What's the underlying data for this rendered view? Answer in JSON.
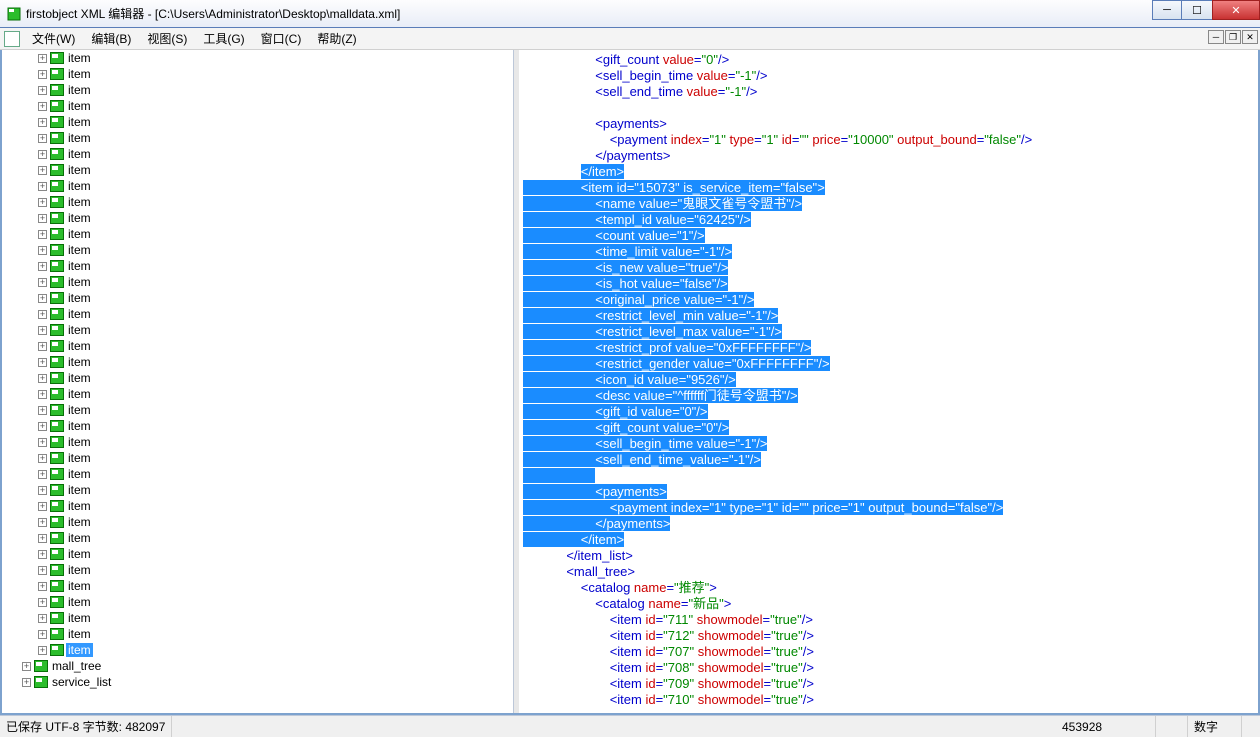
{
  "window": {
    "title": "firstobject XML 编辑器 - [C:\\Users\\Administrator\\Desktop\\malldata.xml]"
  },
  "menu": {
    "file": "文件(W)",
    "edit": "编辑(B)",
    "view": "视图(S)",
    "tools": "工具(G)",
    "window": "窗口(C)",
    "help": "帮助(Z)"
  },
  "tree": {
    "item_label": "item",
    "mall_tree": "mall_tree",
    "service_list": "service_list",
    "repeat_count": 38
  },
  "code_lines": [
    {
      "indent": 5,
      "selected": false,
      "tokens": [
        [
          "tag",
          "<gift_count "
        ],
        [
          "attr-name",
          "value"
        ],
        [
          "tag",
          "="
        ],
        [
          "attr-val",
          "\"0\""
        ],
        [
          "tag",
          "/>"
        ]
      ]
    },
    {
      "indent": 5,
      "selected": false,
      "tokens": [
        [
          "tag",
          "<sell_begin_time "
        ],
        [
          "attr-name",
          "value"
        ],
        [
          "tag",
          "="
        ],
        [
          "attr-val",
          "\"-1\""
        ],
        [
          "tag",
          "/>"
        ]
      ]
    },
    {
      "indent": 5,
      "selected": false,
      "tokens": [
        [
          "tag",
          "<sell_end_time "
        ],
        [
          "attr-name",
          "value"
        ],
        [
          "tag",
          "="
        ],
        [
          "attr-val",
          "\"-1\""
        ],
        [
          "tag",
          "/>"
        ]
      ]
    },
    {
      "indent": 0,
      "selected": false,
      "tokens": []
    },
    {
      "indent": 5,
      "selected": false,
      "tokens": [
        [
          "tag",
          "<payments>"
        ]
      ]
    },
    {
      "indent": 6,
      "selected": false,
      "tokens": [
        [
          "tag",
          "<payment "
        ],
        [
          "attr-name",
          "index"
        ],
        [
          "tag",
          "="
        ],
        [
          "attr-val",
          "\"1\""
        ],
        [
          "tag",
          " "
        ],
        [
          "attr-name",
          "type"
        ],
        [
          "tag",
          "="
        ],
        [
          "attr-val",
          "\"1\""
        ],
        [
          "tag",
          " "
        ],
        [
          "attr-name",
          "id"
        ],
        [
          "tag",
          "="
        ],
        [
          "attr-val",
          "\"\""
        ],
        [
          "tag",
          " "
        ],
        [
          "attr-name",
          "price"
        ],
        [
          "tag",
          "="
        ],
        [
          "attr-val",
          "\"10000\""
        ],
        [
          "tag",
          " "
        ],
        [
          "attr-name",
          "output_bound"
        ],
        [
          "tag",
          "="
        ],
        [
          "attr-val",
          "\"false\""
        ],
        [
          "tag",
          "/>"
        ]
      ]
    },
    {
      "indent": 5,
      "selected": false,
      "tokens": [
        [
          "tag",
          "</payments>"
        ]
      ]
    },
    {
      "indent": 4,
      "selected": true,
      "tokens": [
        [
          "tag",
          "</item>"
        ]
      ]
    },
    {
      "indent": 4,
      "selected": true,
      "tokens": [
        [
          "tag",
          "<item "
        ],
        [
          "attr-name",
          "id"
        ],
        [
          "tag",
          "="
        ],
        [
          "attr-val",
          "\"15073\""
        ],
        [
          "tag",
          " "
        ],
        [
          "attr-name",
          "is_service_item"
        ],
        [
          "tag",
          "="
        ],
        [
          "attr-val",
          "\"false\""
        ],
        [
          "tag",
          ">"
        ]
      ]
    },
    {
      "indent": 5,
      "selected": true,
      "tokens": [
        [
          "tag",
          "<name "
        ],
        [
          "attr-name",
          "value"
        ],
        [
          "tag",
          "="
        ],
        [
          "attr-val",
          "\"鬼眼文雀号令盟书\""
        ],
        [
          "tag",
          "/>"
        ]
      ]
    },
    {
      "indent": 5,
      "selected": true,
      "tokens": [
        [
          "tag",
          "<templ_id "
        ],
        [
          "attr-name",
          "value"
        ],
        [
          "tag",
          "="
        ],
        [
          "attr-val",
          "\"62425\""
        ],
        [
          "tag",
          "/>"
        ]
      ]
    },
    {
      "indent": 5,
      "selected": true,
      "tokens": [
        [
          "tag",
          "<count "
        ],
        [
          "attr-name",
          "value"
        ],
        [
          "tag",
          "="
        ],
        [
          "attr-val",
          "\"1\""
        ],
        [
          "tag",
          "/>"
        ]
      ]
    },
    {
      "indent": 5,
      "selected": true,
      "tokens": [
        [
          "tag",
          "<time_limit "
        ],
        [
          "attr-name",
          "value"
        ],
        [
          "tag",
          "="
        ],
        [
          "attr-val",
          "\"-1\""
        ],
        [
          "tag",
          "/>"
        ]
      ]
    },
    {
      "indent": 5,
      "selected": true,
      "tokens": [
        [
          "tag",
          "<is_new "
        ],
        [
          "attr-name",
          "value"
        ],
        [
          "tag",
          "="
        ],
        [
          "attr-val",
          "\"true\""
        ],
        [
          "tag",
          "/>"
        ]
      ]
    },
    {
      "indent": 5,
      "selected": true,
      "tokens": [
        [
          "tag",
          "<is_hot "
        ],
        [
          "attr-name",
          "value"
        ],
        [
          "tag",
          "="
        ],
        [
          "attr-val",
          "\"false\""
        ],
        [
          "tag",
          "/>"
        ]
      ]
    },
    {
      "indent": 5,
      "selected": true,
      "tokens": [
        [
          "tag",
          "<original_price "
        ],
        [
          "attr-name",
          "value"
        ],
        [
          "tag",
          "="
        ],
        [
          "attr-val",
          "\"-1\""
        ],
        [
          "tag",
          "/>"
        ]
      ]
    },
    {
      "indent": 5,
      "selected": true,
      "tokens": [
        [
          "tag",
          "<restrict_level_min "
        ],
        [
          "attr-name",
          "value"
        ],
        [
          "tag",
          "="
        ],
        [
          "attr-val",
          "\"-1\""
        ],
        [
          "tag",
          "/>"
        ]
      ]
    },
    {
      "indent": 5,
      "selected": true,
      "tokens": [
        [
          "tag",
          "<restrict_level_max "
        ],
        [
          "attr-name",
          "value"
        ],
        [
          "tag",
          "="
        ],
        [
          "attr-val",
          "\"-1\""
        ],
        [
          "tag",
          "/>"
        ]
      ]
    },
    {
      "indent": 5,
      "selected": true,
      "tokens": [
        [
          "tag",
          "<restrict_prof "
        ],
        [
          "attr-name",
          "value"
        ],
        [
          "tag",
          "="
        ],
        [
          "attr-val",
          "\"0xFFFFFFFF\""
        ],
        [
          "tag",
          "/>"
        ]
      ]
    },
    {
      "indent": 5,
      "selected": true,
      "tokens": [
        [
          "tag",
          "<restrict_gender "
        ],
        [
          "attr-name",
          "value"
        ],
        [
          "tag",
          "="
        ],
        [
          "attr-val",
          "\"0xFFFFFFFF\""
        ],
        [
          "tag",
          "/>"
        ]
      ]
    },
    {
      "indent": 5,
      "selected": true,
      "tokens": [
        [
          "tag",
          "<icon_id "
        ],
        [
          "attr-name",
          "value"
        ],
        [
          "tag",
          "="
        ],
        [
          "attr-val",
          "\"9526\""
        ],
        [
          "tag",
          "/>"
        ]
      ]
    },
    {
      "indent": 5,
      "selected": true,
      "tokens": [
        [
          "tag",
          "<desc "
        ],
        [
          "attr-name",
          "value"
        ],
        [
          "tag",
          "="
        ],
        [
          "attr-val",
          "\"^ffffff门徒号令盟书\""
        ],
        [
          "tag",
          "/>"
        ]
      ]
    },
    {
      "indent": 5,
      "selected": true,
      "tokens": [
        [
          "tag",
          "<gift_id "
        ],
        [
          "attr-name",
          "value"
        ],
        [
          "tag",
          "="
        ],
        [
          "attr-val",
          "\"0\""
        ],
        [
          "tag",
          "/>"
        ]
      ]
    },
    {
      "indent": 5,
      "selected": true,
      "tokens": [
        [
          "tag",
          "<gift_count "
        ],
        [
          "attr-name",
          "value"
        ],
        [
          "tag",
          "="
        ],
        [
          "attr-val",
          "\"0\""
        ],
        [
          "tag",
          "/>"
        ]
      ]
    },
    {
      "indent": 5,
      "selected": true,
      "tokens": [
        [
          "tag",
          "<sell_begin_time "
        ],
        [
          "attr-name",
          "value"
        ],
        [
          "tag",
          "="
        ],
        [
          "attr-val",
          "\"-1\""
        ],
        [
          "tag",
          "/>"
        ]
      ]
    },
    {
      "indent": 5,
      "selected": true,
      "tokens": [
        [
          "tag",
          "<sell_end_time_"
        ],
        [
          "attr-name",
          "value"
        ],
        [
          "tag",
          "="
        ],
        [
          "attr-val",
          "\"-1\""
        ],
        [
          "tag",
          "/>"
        ]
      ]
    },
    {
      "indent": 5,
      "selected": true,
      "tokens": [
        [
          "txt",
          ""
        ]
      ]
    },
    {
      "indent": 5,
      "selected": true,
      "tokens": [
        [
          "tag",
          "<payments>"
        ]
      ]
    },
    {
      "indent": 6,
      "selected": true,
      "tokens": [
        [
          "tag",
          "<payment "
        ],
        [
          "attr-name",
          "index"
        ],
        [
          "tag",
          "="
        ],
        [
          "attr-val",
          "\"1\""
        ],
        [
          "tag",
          " "
        ],
        [
          "attr-name",
          "type"
        ],
        [
          "tag",
          "="
        ],
        [
          "attr-val",
          "\"1\""
        ],
        [
          "tag",
          " "
        ],
        [
          "attr-name",
          "id"
        ],
        [
          "tag",
          "="
        ],
        [
          "attr-val",
          "\"\""
        ],
        [
          "tag",
          " "
        ],
        [
          "attr-name",
          "price"
        ],
        [
          "tag",
          "="
        ],
        [
          "attr-val",
          "\"1\""
        ],
        [
          "tag",
          " "
        ],
        [
          "attr-name",
          "output_bound"
        ],
        [
          "tag",
          "="
        ],
        [
          "attr-val",
          "\"false\""
        ],
        [
          "tag",
          "/>"
        ]
      ]
    },
    {
      "indent": 5,
      "selected": true,
      "tokens": [
        [
          "tag",
          "</payments>"
        ]
      ]
    },
    {
      "indent": 4,
      "selected": true,
      "tokens": [
        [
          "tag",
          "</item>"
        ]
      ]
    },
    {
      "indent": 3,
      "selected": false,
      "tokens": [
        [
          "tag",
          "</item_list>"
        ]
      ]
    },
    {
      "indent": 3,
      "selected": false,
      "tokens": [
        [
          "tag",
          "<mall_tree>"
        ]
      ]
    },
    {
      "indent": 4,
      "selected": false,
      "tokens": [
        [
          "tag",
          "<catalog "
        ],
        [
          "attr-name",
          "name"
        ],
        [
          "tag",
          "="
        ],
        [
          "attr-val",
          "\"推荐\""
        ],
        [
          "tag",
          ">"
        ]
      ]
    },
    {
      "indent": 5,
      "selected": false,
      "tokens": [
        [
          "tag",
          "<catalog "
        ],
        [
          "attr-name",
          "name"
        ],
        [
          "tag",
          "="
        ],
        [
          "attr-val",
          "\"新品\""
        ],
        [
          "tag",
          ">"
        ]
      ]
    },
    {
      "indent": 6,
      "selected": false,
      "tokens": [
        [
          "tag",
          "<item "
        ],
        [
          "attr-name",
          "id"
        ],
        [
          "tag",
          "="
        ],
        [
          "attr-val",
          "\"711\""
        ],
        [
          "tag",
          " "
        ],
        [
          "attr-name",
          "showmodel"
        ],
        [
          "tag",
          "="
        ],
        [
          "attr-val",
          "\"true\""
        ],
        [
          "tag",
          "/>"
        ]
      ]
    },
    {
      "indent": 6,
      "selected": false,
      "tokens": [
        [
          "tag",
          "<item "
        ],
        [
          "attr-name",
          "id"
        ],
        [
          "tag",
          "="
        ],
        [
          "attr-val",
          "\"712\""
        ],
        [
          "tag",
          " "
        ],
        [
          "attr-name",
          "showmodel"
        ],
        [
          "tag",
          "="
        ],
        [
          "attr-val",
          "\"true\""
        ],
        [
          "tag",
          "/>"
        ]
      ]
    },
    {
      "indent": 6,
      "selected": false,
      "tokens": [
        [
          "tag",
          "<item "
        ],
        [
          "attr-name",
          "id"
        ],
        [
          "tag",
          "="
        ],
        [
          "attr-val",
          "\"707\""
        ],
        [
          "tag",
          " "
        ],
        [
          "attr-name",
          "showmodel"
        ],
        [
          "tag",
          "="
        ],
        [
          "attr-val",
          "\"true\""
        ],
        [
          "tag",
          "/>"
        ]
      ]
    },
    {
      "indent": 6,
      "selected": false,
      "tokens": [
        [
          "tag",
          "<item "
        ],
        [
          "attr-name",
          "id"
        ],
        [
          "tag",
          "="
        ],
        [
          "attr-val",
          "\"708\""
        ],
        [
          "tag",
          " "
        ],
        [
          "attr-name",
          "showmodel"
        ],
        [
          "tag",
          "="
        ],
        [
          "attr-val",
          "\"true\""
        ],
        [
          "tag",
          "/>"
        ]
      ]
    },
    {
      "indent": 6,
      "selected": false,
      "tokens": [
        [
          "tag",
          "<item "
        ],
        [
          "attr-name",
          "id"
        ],
        [
          "tag",
          "="
        ],
        [
          "attr-val",
          "\"709\""
        ],
        [
          "tag",
          " "
        ],
        [
          "attr-name",
          "showmodel"
        ],
        [
          "tag",
          "="
        ],
        [
          "attr-val",
          "\"true\""
        ],
        [
          "tag",
          "/>"
        ]
      ]
    },
    {
      "indent": 6,
      "selected": false,
      "tokens": [
        [
          "tag",
          "<item "
        ],
        [
          "attr-name",
          "id"
        ],
        [
          "tag",
          "="
        ],
        [
          "attr-val",
          "\"710\""
        ],
        [
          "tag",
          " "
        ],
        [
          "attr-name",
          "showmodel"
        ],
        [
          "tag",
          "="
        ],
        [
          "attr-val",
          "\"true\""
        ],
        [
          "tag",
          "/>"
        ]
      ]
    }
  ],
  "status": {
    "left": "已保存 UTF-8 字节数: 482097",
    "pos": "453928",
    "mode": "数字"
  }
}
